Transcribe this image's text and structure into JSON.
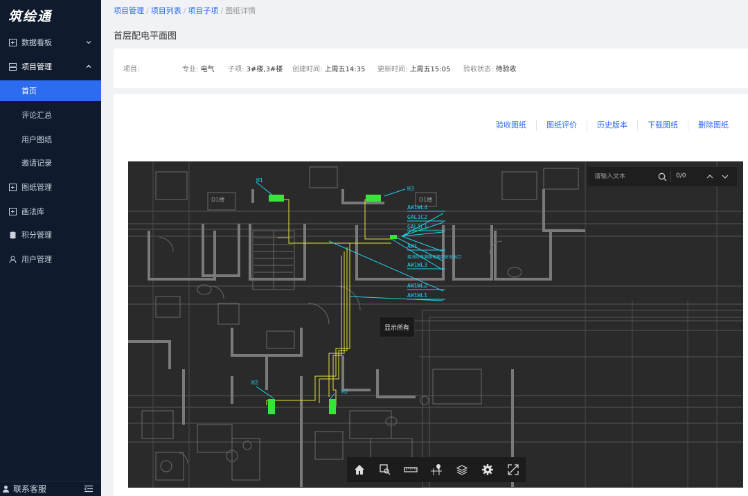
{
  "app": {
    "logo_text": "筑绘通"
  },
  "sidebar": {
    "items": [
      {
        "label": "数据看板",
        "icon": "dashboard-icon",
        "chevron": "down"
      },
      {
        "label": "项目管理",
        "icon": "project-icon",
        "chevron": "up"
      },
      {
        "label": "首页",
        "active": true
      },
      {
        "label": "评论汇总"
      },
      {
        "label": "用户图纸"
      },
      {
        "label": "邀请记录"
      },
      {
        "label": "图纸管理",
        "icon": "drawing-icon"
      },
      {
        "label": "画法库",
        "icon": "library-icon"
      },
      {
        "label": "积分管理",
        "icon": "coins-icon"
      },
      {
        "label": "用户管理",
        "icon": "user-icon"
      }
    ],
    "footer_label": "联系客服"
  },
  "breadcrumb": {
    "items": [
      "项目管理",
      "项目列表",
      "项目子项",
      "图纸详情"
    ],
    "separator": "/"
  },
  "page": {
    "title": "首层配电平面图"
  },
  "info": {
    "project_label": "项目:",
    "discipline_label": "专业:",
    "discipline_value": "电气",
    "subitem_label": "子项:",
    "subitem_value": "3#楼,3#楼",
    "created_label": "创建时间:",
    "created_value": "上周五14:35",
    "updated_label": "更新时间:",
    "updated_value": "上周五15:05",
    "status_label": "验收状态:",
    "status_value": "待验收"
  },
  "actions": [
    "验收图纸",
    "图纸评价",
    "历史版本",
    "下载图纸",
    "删除图纸"
  ],
  "viewer": {
    "search_placeholder": "请输入文本",
    "search_count": "0/0",
    "tooltip": "显示所有",
    "cad_labels": {
      "h1": "H1",
      "h3": "H3",
      "h2a": "H2",
      "h2b": "H2",
      "d1a": "D1楼",
      "d1b": "D1楼",
      "cables": [
        "AW1WL4",
        "GAL1C2",
        "GAL1C1",
        "AW1",
        "接消防电源强电箱到安全出口",
        "AW1WL3",
        "AW1WL2",
        "AW1WL1"
      ]
    },
    "toolbar_icons": [
      "home-icon",
      "zoom-window-icon",
      "measure-icon",
      "location-pin-icon",
      "layers-icon",
      "settings-icon",
      "fullscreen-icon"
    ]
  },
  "colors": {
    "sidebar_bg": "#0f1b2d",
    "accent": "#2d6cf0",
    "cad_bg": "#2a2a2a",
    "cad_cyan": "#22d3ee",
    "cad_yellow": "#e8e23a",
    "cad_green": "#39e33a"
  }
}
